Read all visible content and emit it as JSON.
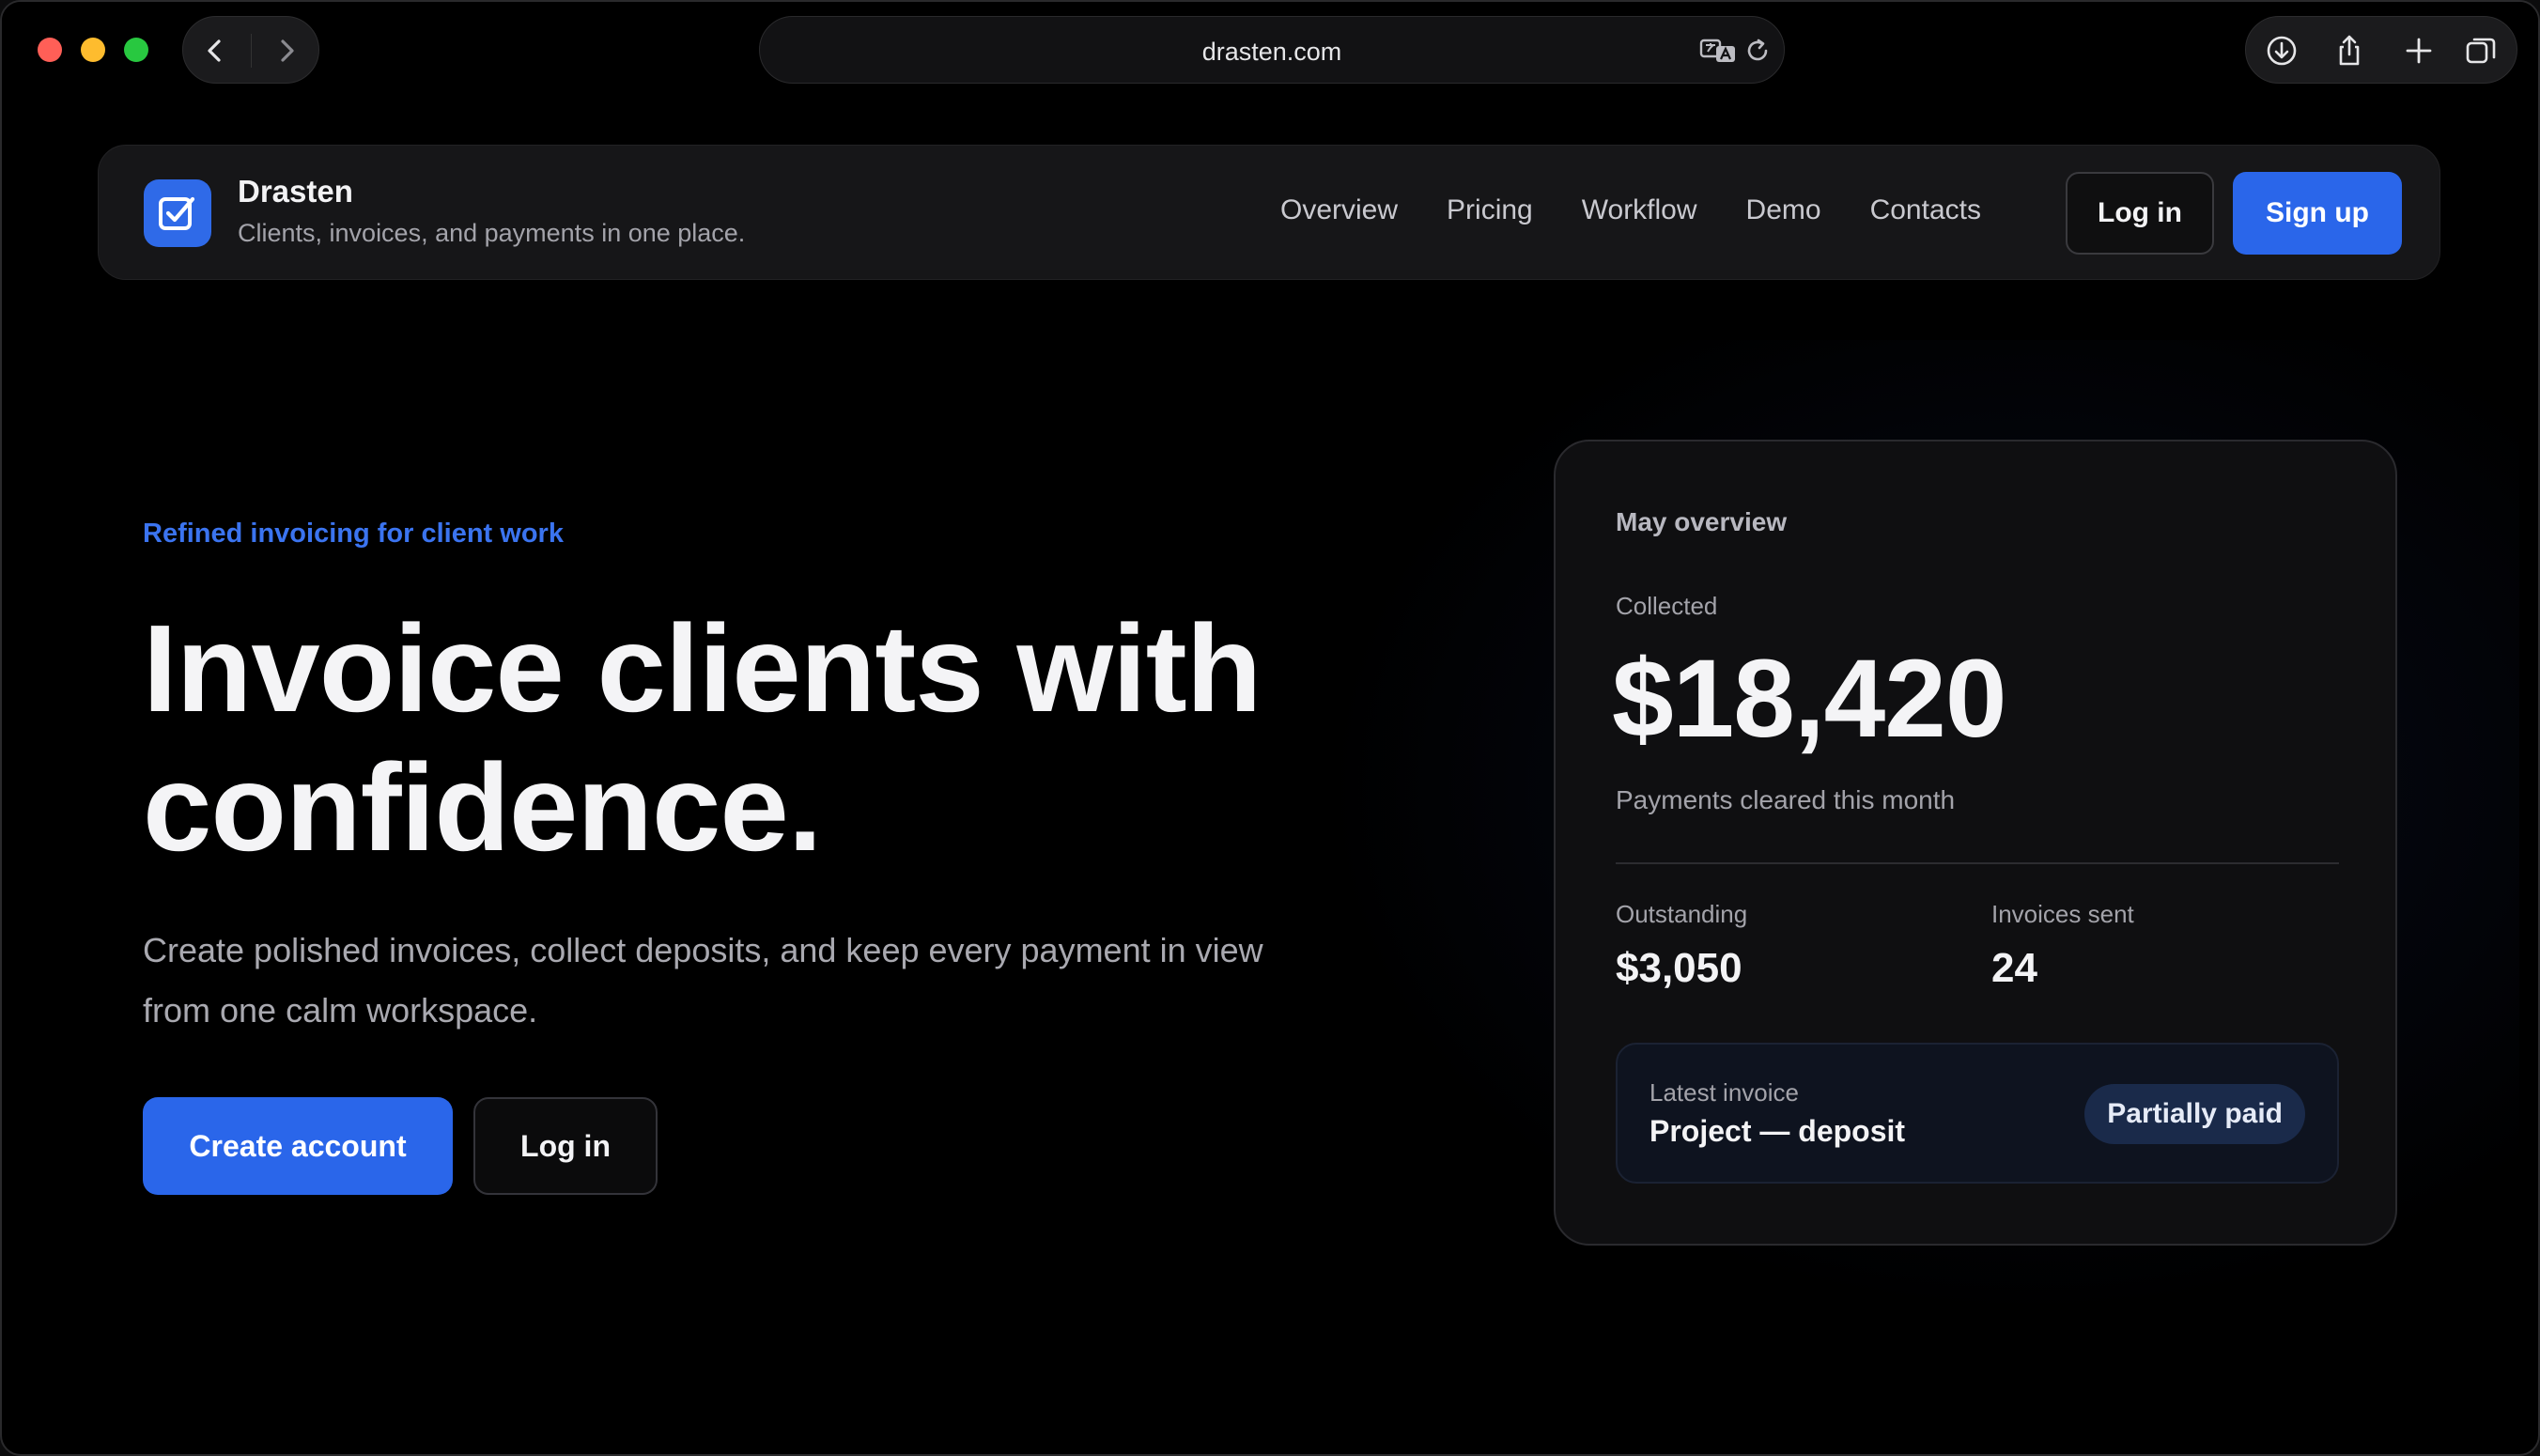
{
  "browser": {
    "url": "drasten.com",
    "icons": {
      "back": "chevron-left-icon",
      "forward": "chevron-right-icon",
      "translate": "translate-icon",
      "reload": "reload-icon",
      "download": "download-icon",
      "share": "share-icon",
      "new_tab": "plus-icon",
      "tab_overview": "tabs-icon"
    }
  },
  "header": {
    "brand_name": "Drasten",
    "brand_tagline": "Clients, invoices, and payments in one place.",
    "logo_icon": "checkbox-pen-icon",
    "nav": [
      {
        "label": "Overview"
      },
      {
        "label": "Pricing"
      },
      {
        "label": "Workflow"
      },
      {
        "label": "Demo"
      },
      {
        "label": "Contacts"
      }
    ],
    "login_label": "Log in",
    "signup_label": "Sign up"
  },
  "hero": {
    "eyebrow": "Refined invoicing for client work",
    "title": "Invoice clients with confidence.",
    "subtitle": "Create polished invoices, collect deposits, and keep every payment in view from one calm workspace.",
    "primary_cta": "Create account",
    "secondary_cta": "Log in"
  },
  "overview_card": {
    "title": "May overview",
    "collected_label": "Collected",
    "collected_value": "$18,420",
    "collected_note": "Payments cleared this month",
    "outstanding_label": "Outstanding",
    "outstanding_value": "$3,050",
    "invoices_sent_label": "Invoices sent",
    "invoices_sent_value": "24",
    "latest_invoice_label": "Latest invoice",
    "latest_invoice_name": "Project — deposit",
    "latest_invoice_status": "Partially paid"
  },
  "colors": {
    "accent": "#2a66ea",
    "eyebrow": "#3b74f0",
    "background": "#000000",
    "card": "#0f0f11",
    "status_badge": "#1a2a4a"
  }
}
